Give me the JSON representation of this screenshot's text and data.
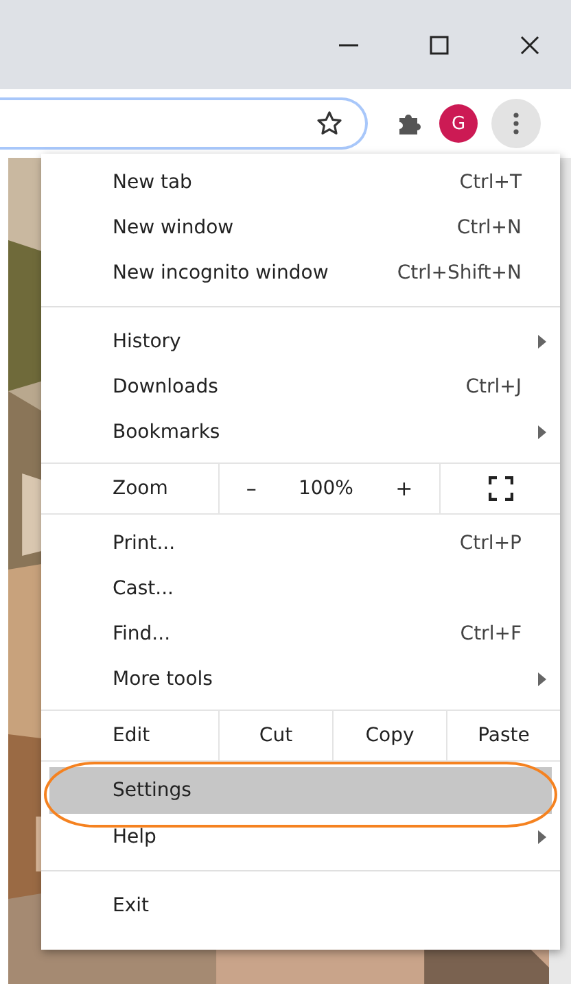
{
  "toolbar": {
    "avatar": "G"
  },
  "menu": [
    {
      "kind": "item",
      "label": "New tab",
      "shortcut": "Ctrl+T",
      "submenu": false,
      "selected": false
    },
    {
      "kind": "item",
      "label": "New window",
      "shortcut": "Ctrl+N",
      "submenu": false,
      "selected": false
    },
    {
      "kind": "item",
      "label": "New incognito window",
      "shortcut": "Ctrl+Shift+N",
      "submenu": false,
      "selected": false
    },
    {
      "kind": "separator"
    },
    {
      "kind": "item",
      "label": "History",
      "submenu": true,
      "selected": false
    },
    {
      "kind": "item",
      "label": "Downloads",
      "shortcut": "Ctrl+J",
      "submenu": false,
      "selected": false
    },
    {
      "kind": "item",
      "label": "Bookmarks",
      "submenu": true,
      "selected": false
    },
    {
      "kind": "zoom",
      "label": "Zoom",
      "minus": "–",
      "value": "100%",
      "plus": "+"
    },
    {
      "kind": "item",
      "label": "Print...",
      "shortcut": "Ctrl+P",
      "submenu": false,
      "selected": false
    },
    {
      "kind": "item",
      "label": "Cast...",
      "submenu": false,
      "selected": false
    },
    {
      "kind": "item",
      "label": "Find...",
      "shortcut": "Ctrl+F",
      "submenu": false,
      "selected": false
    },
    {
      "kind": "item",
      "label": "More tools",
      "submenu": true,
      "selected": false
    },
    {
      "kind": "edit",
      "label": "Edit",
      "actions": [
        "Cut",
        "Copy",
        "Paste"
      ]
    },
    {
      "kind": "item",
      "label": "Settings",
      "submenu": false,
      "selected": true
    },
    {
      "kind": "item",
      "label": "Help",
      "submenu": true,
      "selected": false
    },
    {
      "kind": "separator"
    },
    {
      "kind": "item",
      "label": "Exit",
      "submenu": false,
      "selected": false
    }
  ]
}
